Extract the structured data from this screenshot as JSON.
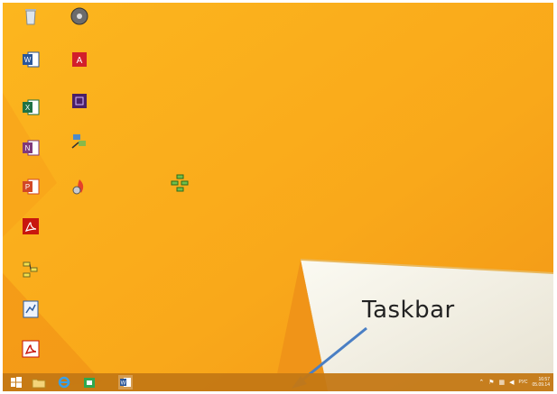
{
  "annotation": {
    "text": "Taskbar"
  },
  "taskbar": {
    "pinned": [
      {
        "id": "start",
        "icon": "windows-logo-icon"
      },
      {
        "id": "explorer",
        "icon": "folder-icon"
      },
      {
        "id": "ie",
        "icon": "internet-explorer-icon"
      },
      {
        "id": "store",
        "icon": "store-icon"
      },
      {
        "id": "word",
        "icon": "word-icon"
      }
    ],
    "tray": {
      "language": "РУС",
      "time": "16:57",
      "date": "05.09.14"
    }
  },
  "colors": {
    "wallpaper": "#f9b21a",
    "wallpaper_dark": "#f08a12",
    "taskbar": "#c47814"
  }
}
